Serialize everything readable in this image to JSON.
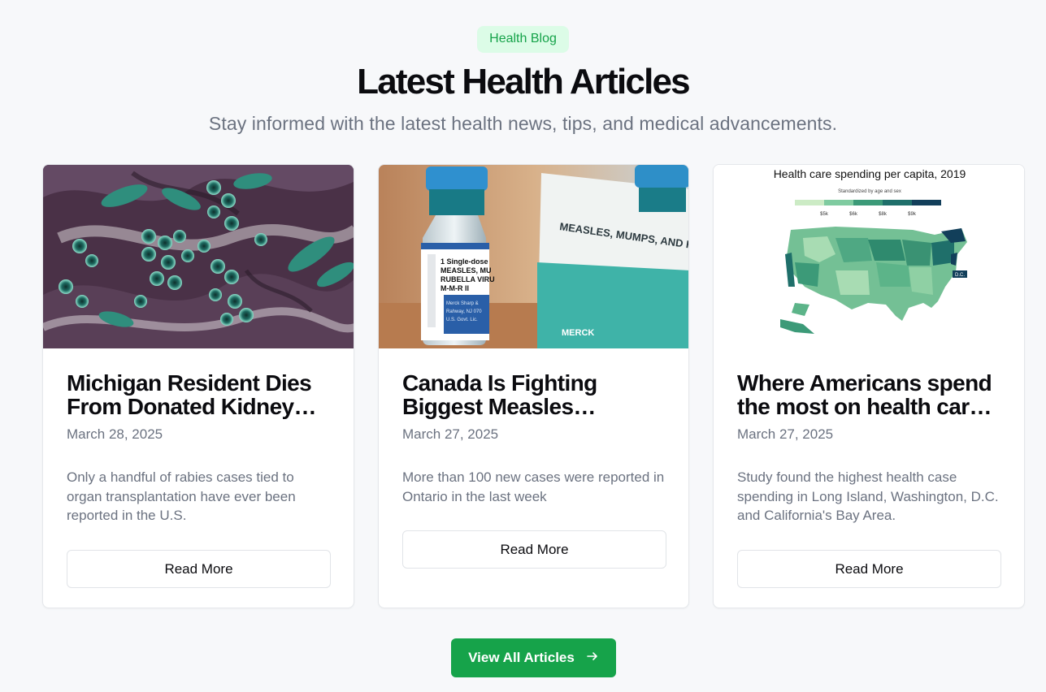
{
  "header": {
    "badge": "Health Blog",
    "title": "Latest Health Articles",
    "subtitle": "Stay informed with the latest health news, tips, and medical advancements."
  },
  "articles": [
    {
      "title": "Michigan Resident Dies\nFrom Donated Kidney…",
      "date": "March 28, 2025",
      "excerpt": "Only a handful of rabies cases tied to organ transplantation have ever been reported in the U.S.",
      "button": "Read More",
      "image": "rabies-virus-micrograph"
    },
    {
      "title": "Canada Is Fighting\nBiggest Measles…",
      "date": "March 27, 2025",
      "excerpt": "More than 100 new cases were reported in Ontario in the last week",
      "button": "Read More",
      "image": "mmr-vaccine-vials"
    },
    {
      "title": "Where Americans spend\nthe most on health car…",
      "date": "March 27, 2025",
      "excerpt": "Study found the highest health case spending in Long Island, Washington, D.C. and California's Bay Area.",
      "button": "Read More",
      "image": "us-health-spending-map"
    }
  ],
  "image_text": {
    "vial_label": "1 Single-dose\nMEASLES, MU\nRUBELLA VIRU\nM-M-R II",
    "vial_maker": "Merck Sharp &\nRahway, NJ 070\nU.S. Govt. Lic.",
    "box_label": "MEASLES, MUMPS, AND RUBELLA",
    "box_brand": "MERCK",
    "map_title": "Health care spending per capita, 2019",
    "map_subtitle": "Standardized by age and sex",
    "map_legend": [
      "$5k",
      "$6k",
      "$8k",
      "$9k"
    ],
    "map_dc_label": "D.C."
  },
  "footer": {
    "view_all_label": "View All Articles",
    "arrow_icon": "arrow-right-icon"
  },
  "colors": {
    "accent": "#16a34a",
    "badge_bg": "#dcfce7",
    "background": "#f7f8fa",
    "muted_text": "#6b7280"
  }
}
